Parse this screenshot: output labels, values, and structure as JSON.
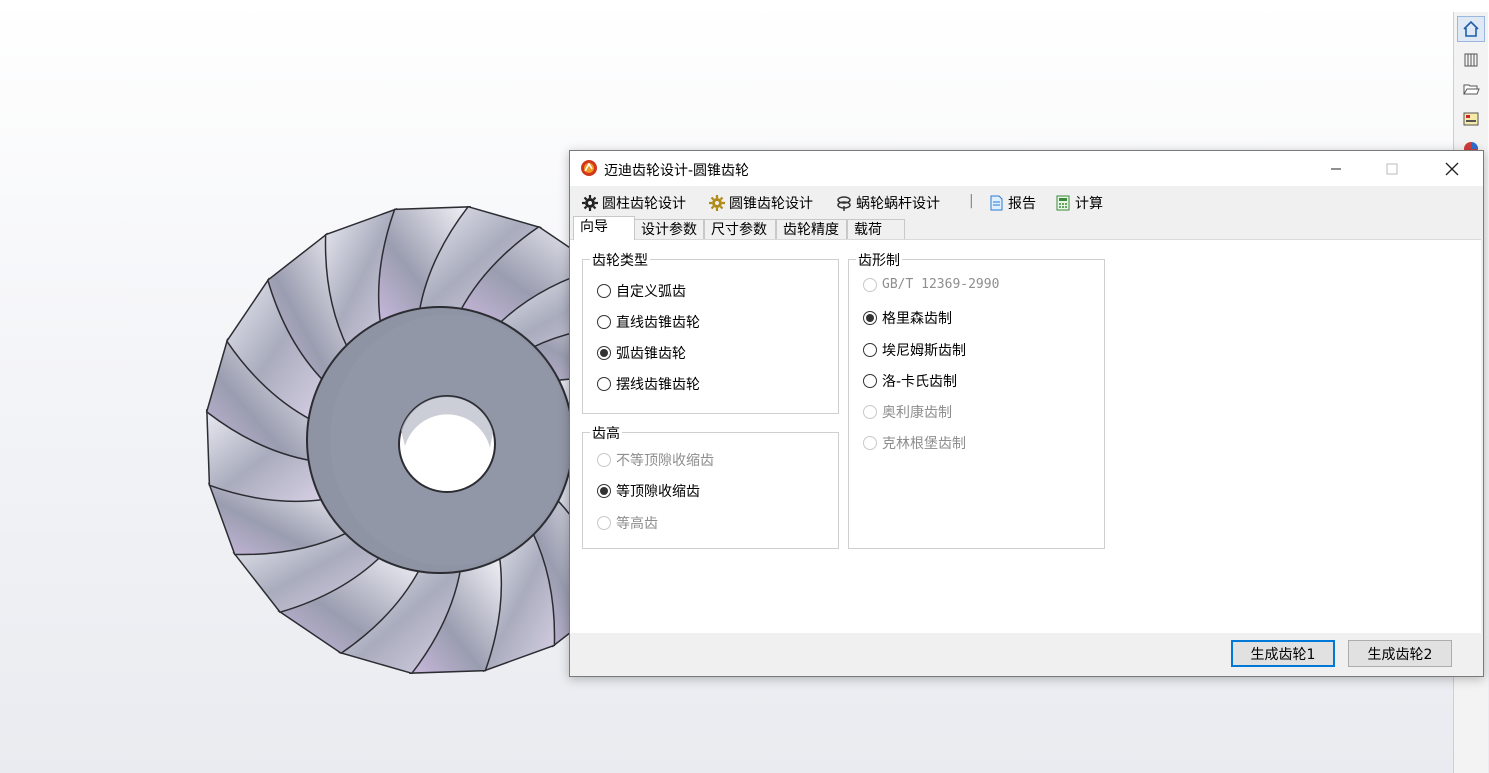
{
  "window": {
    "title": "迈迪齿轮设计-圆锥齿轮",
    "minimize_glyph": "—",
    "maximize_glyph": "☐",
    "close_glyph": "✕"
  },
  "menubar": {
    "items": [
      {
        "label": "圆柱齿轮设计",
        "icon": "gear-icon"
      },
      {
        "label": "圆锥齿轮设计",
        "icon": "bevel-gear-icon"
      },
      {
        "label": "蜗轮蜗杆设计",
        "icon": "worm-gear-icon"
      },
      {
        "label": "报告",
        "icon": "report-icon"
      },
      {
        "label": "计算",
        "icon": "calculator-icon"
      }
    ],
    "separator": "|"
  },
  "tabs": [
    {
      "label": "向导",
      "active": true
    },
    {
      "label": "设计参数",
      "active": false
    },
    {
      "label": "尺寸参数",
      "active": false
    },
    {
      "label": "齿轮精度",
      "active": false
    },
    {
      "label": "载荷",
      "active": false
    }
  ],
  "groups": {
    "gear_type": {
      "title": "齿轮类型",
      "options": [
        {
          "label": "自定义弧齿",
          "checked": false,
          "enabled": true
        },
        {
          "label": "直线齿锥齿轮",
          "checked": false,
          "enabled": true
        },
        {
          "label": "弧齿锥齿轮",
          "checked": true,
          "enabled": true
        },
        {
          "label": "摆线齿锥齿轮",
          "checked": false,
          "enabled": true
        }
      ]
    },
    "tooth_height": {
      "title": "齿高",
      "options": [
        {
          "label": "不等顶隙收缩齿",
          "checked": false,
          "enabled": false
        },
        {
          "label": "等顶隙收缩齿",
          "checked": true,
          "enabled": true
        },
        {
          "label": "等高齿",
          "checked": false,
          "enabled": false
        }
      ]
    },
    "tooth_system": {
      "title": "齿形制",
      "options": [
        {
          "label": "GB/T 12369-2990",
          "checked": false,
          "enabled": false
        },
        {
          "label": "格里森齿制",
          "checked": true,
          "enabled": true
        },
        {
          "label": "埃尼姆斯齿制",
          "checked": false,
          "enabled": true
        },
        {
          "label": "洛-卡氏齿制",
          "checked": false,
          "enabled": true
        },
        {
          "label": "奥利康齿制",
          "checked": false,
          "enabled": false
        },
        {
          "label": "克林根堡齿制",
          "checked": false,
          "enabled": false
        }
      ]
    }
  },
  "buttons": {
    "generate1": "生成齿轮1",
    "generate2": "生成齿轮2"
  },
  "taskpane": {
    "icons": [
      "home-icon",
      "parts-library-icon",
      "folder-open-icon",
      "properties-icon",
      "appearance-icon"
    ]
  },
  "colors": {
    "accent": "#0078d7",
    "gear_body": "#8e93a3",
    "gear_tooth": "#b9bccb"
  }
}
